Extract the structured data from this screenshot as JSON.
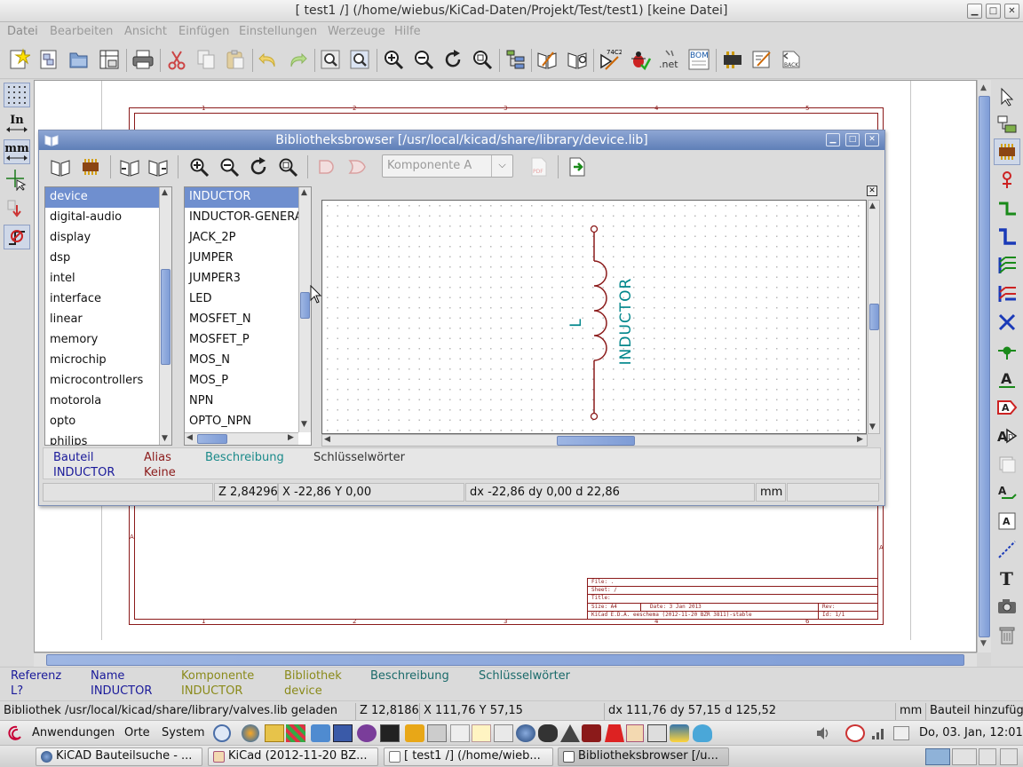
{
  "window": {
    "title": "[ test1 /] (/home/wiebus/KiCad-Daten/Projekt/Test/test1) [keine Datei]"
  },
  "menu": [
    "Datei",
    "Bearbeiten",
    "Ansicht",
    "Einfügen",
    "Einstellungen",
    "Werzeuge",
    "Hilfe"
  ],
  "toolbar_icons": [
    "new-schematic-icon",
    "new-sheet-icon",
    "open-icon",
    "save-icon",
    "page-settings-icon",
    "print-icon",
    "cut-icon",
    "copy-icon",
    "paste-icon",
    "undo-icon",
    "redo-icon",
    "find-icon",
    "find-replace-icon",
    "zoom-in-icon",
    "zoom-out-icon",
    "redraw-icon",
    "zoom-fit-icon",
    "hierarchy-navigator-icon",
    "library-editor-icon",
    "library-browser-icon",
    "annotate-icon",
    "erc-icon",
    "netlist-icon",
    "bom-icon",
    "cvpcb-icon",
    "pcbnew-icon",
    "back-annotate-icon"
  ],
  "toolbar_texts": {
    "annotate": "74C2",
    "netlist": ".net",
    "bom": "BOM",
    "back": "BACK"
  },
  "left_toolbar": {
    "inches_label": "In",
    "mm_label": "mm"
  },
  "canvas": {
    "ruler_top": [
      "1",
      "2",
      "3",
      "4",
      "5"
    ],
    "ruler_bottom": [
      "1",
      "2",
      "3",
      "4",
      "5",
      "6"
    ],
    "ruler_side_left": "A",
    "ruler_side_right": "A",
    "title_block": {
      "file": "File: .",
      "sheet": "Sheet: /",
      "title": "Title:",
      "size": "Size: A4",
      "date": "Date: 3 Jan 2013",
      "rev": "Rev:",
      "generator": "KiCad E.D.A.  eeschema (2012-11-20 BZR 3811)-stable",
      "id": "Id: 1/1"
    }
  },
  "dialog": {
    "title": "Bibliotheksbrowser [/usr/local/kicad/share/library/device.lib]",
    "component_combo": "Komponente A",
    "libraries": [
      "device",
      "digital-audio",
      "display",
      "dsp",
      "intel",
      "interface",
      "linear",
      "memory",
      "microchip",
      "microcontrollers",
      "motorola",
      "opto",
      "philips"
    ],
    "selected_library": "device",
    "components": [
      "INDUCTOR",
      "INDUCTOR-GENERAL",
      "JACK_2P",
      "JUMPER",
      "JUMPER3",
      "LED",
      "MOSFET_N",
      "MOSFET_P",
      "MOS_N",
      "MOS_P",
      "NPN",
      "OPTO_NPN"
    ],
    "selected_component": "INDUCTOR",
    "symbol": {
      "reference": "L",
      "value": "INDUCTOR"
    },
    "info": {
      "bauteil_h": "Bauteil",
      "bauteil_v": "INDUCTOR",
      "alias_h": "Alias",
      "alias_v": "Keine",
      "beschreibung_h": "Beschreibung",
      "schluessel_h": "Schlüsselwörter"
    },
    "status": {
      "zoom": "Z 2,84296",
      "xy": "X -22,86  Y 0,00",
      "dxy": "dx -22,86  dy 0,00  d 22,86",
      "units": "mm"
    }
  },
  "infoline": {
    "referenz_h": "Referenz",
    "referenz_v": "L?",
    "name_h": "Name",
    "name_v": "INDUCTOR",
    "komponente_h": "Komponente",
    "komponente_v": "INDUCTOR",
    "bibliothek_h": "Bibliothek",
    "bibliothek_v": "device",
    "beschreibung_h": "Beschreibung",
    "schluessel_h": "Schlüsselwörter"
  },
  "statusbar": {
    "message": "Bibliothek /usr/local/kicad/share/library/valves.lib geladen",
    "zoom": "Z 12,8186",
    "xy": "X 111,76  Y 57,15",
    "dxy": "dx 111,76  dy 57,15  d 125,52",
    "units": "mm",
    "mode": "Bauteil hinzufüg"
  },
  "panel": {
    "menu_apps": "Anwendungen",
    "menu_places": "Orte",
    "menu_system": "System",
    "clock": "Do, 03. Jan, 12:01"
  },
  "taskbar": {
    "tasks": [
      "KiCAD Bauteilsuche - ...",
      "KiCad (2012-11-20 BZ...",
      "[ test1 /] (/home/wieb...",
      "Bibliotheksbrowser [/u..."
    ]
  },
  "colors": {
    "component_red": "#8b1a1a",
    "field_teal": "#00868b",
    "selection": "#6f8fcf",
    "title_blue": "#6f8bc2"
  }
}
